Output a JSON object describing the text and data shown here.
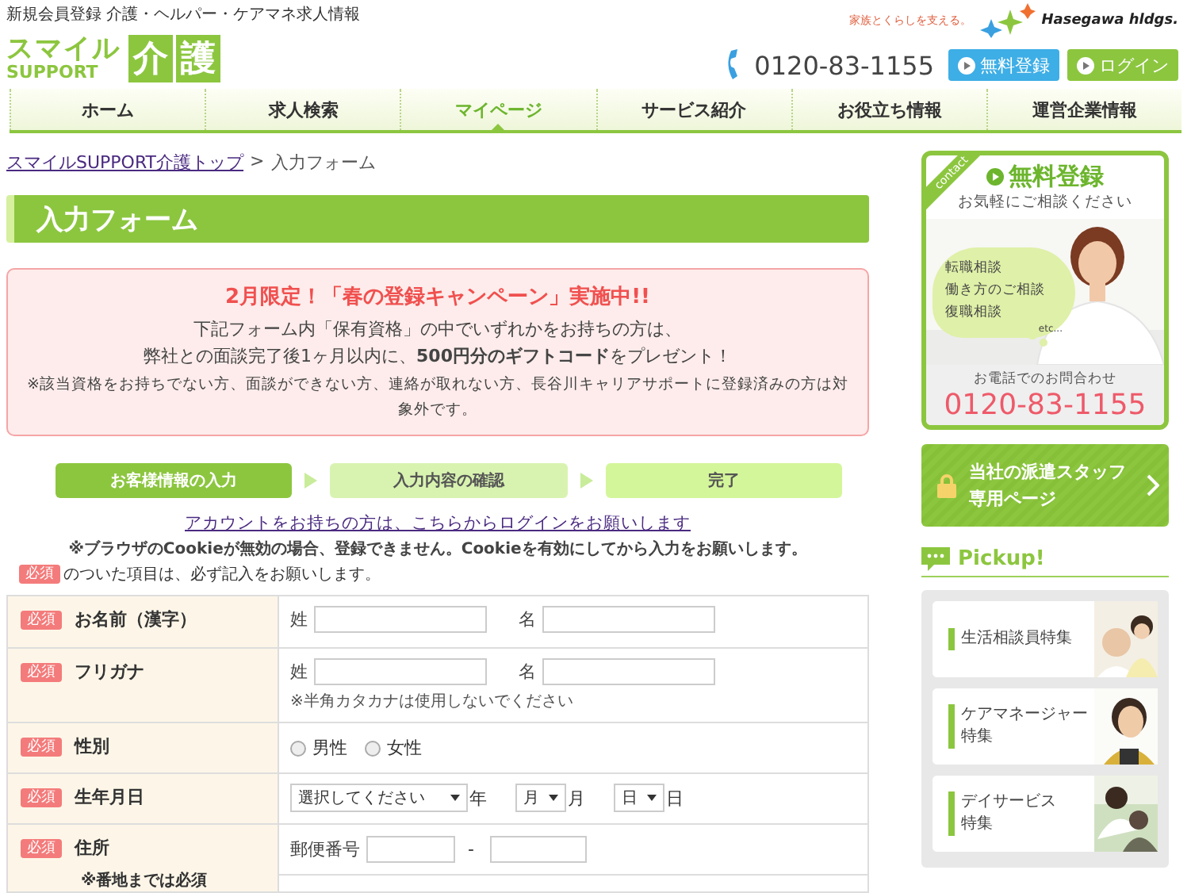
{
  "header": {
    "tagline": "新規会員登録 介護・ヘルパー・ケアマネ求人情報",
    "logo": {
      "line1": "スマイル",
      "line2": "SUPPORT",
      "kanji": [
        "介",
        "護"
      ]
    },
    "group_slogan": "家族とくらしを支える。",
    "group_name": "Hasegawa hldgs.",
    "phone": "0120-83-1155",
    "buttons": [
      {
        "label": "無料登録",
        "kind": "register"
      },
      {
        "label": "ログイン",
        "kind": "login"
      }
    ]
  },
  "nav": [
    {
      "label": "ホーム",
      "selected": false
    },
    {
      "label": "求人検索",
      "selected": false
    },
    {
      "label": "マイページ",
      "selected": true
    },
    {
      "label": "サービス紹介",
      "selected": false
    },
    {
      "label": "お役立ち情報",
      "selected": false
    },
    {
      "label": "運営企業情報",
      "selected": false
    }
  ],
  "breadcrumb": {
    "link": "スマイルSUPPORT介護トップ",
    "separator": ">",
    "current": "入力フォーム"
  },
  "page_title": "入力フォーム",
  "campaign": {
    "title": "2月限定！「春の登録キャンペーン」実施中!!",
    "lines": [
      "下記フォーム内「保有資格」の中でいずれかをお持ちの方は、",
      "弊社との面談完了後1ヶ月以内に、**500円分のギフトコード**をプレゼント！"
    ],
    "note": "※該当資格をお持ちでない方、面談ができない方、連絡が取れない方、長谷川キャリアサポートに登録済みの方は対象外です。"
  },
  "steps": [
    {
      "label": "お客様情報の入力",
      "selected": true
    },
    {
      "label": "入力内容の確認",
      "selected": false
    },
    {
      "label": "完了",
      "selected": false
    }
  ],
  "login_link": "アカウントをお持ちの方は、こちらからログインをお願いします",
  "cookie_note": "※ブラウザのCookieが無効の場合、登録できません。Cookieを有効にしてから入力をお願いします。",
  "required_note": {
    "badge": "必須",
    "text": "のついた項目は、必ず記入をお願いします。"
  },
  "form_rows": [
    {
      "label": "お名前（漢字）",
      "badge": "必須",
      "kind": "name",
      "fields": [
        {
          "label": "姓"
        },
        {
          "label": "名"
        }
      ]
    },
    {
      "label": "フリガナ",
      "badge": "必須",
      "kind": "name",
      "fields": [
        {
          "label": "姓"
        },
        {
          "label": "名"
        }
      ],
      "hint": "※半角カタカナは使用しないでください"
    },
    {
      "label": "性別",
      "badge": "必須",
      "kind": "radio",
      "options": [
        {
          "label": "男性",
          "checked": false
        },
        {
          "label": "女性",
          "checked": false
        }
      ]
    },
    {
      "label": "生年月日",
      "badge": "必須",
      "kind": "date",
      "selects": [
        {
          "value": "選択してください",
          "unit": "年"
        },
        {
          "value": "月",
          "unit": "月"
        },
        {
          "value": "日",
          "unit": "日"
        }
      ]
    },
    {
      "label": "住所",
      "badge": "必須",
      "kind": "address",
      "note": "※番地までは必須",
      "postal_label": "郵便番号",
      "postal_separator": "-"
    }
  ],
  "sidebar": {
    "contact": {
      "ribbon": "contact",
      "title": "無料登録",
      "subtitle": "お気軽にご相談ください",
      "bubble": [
        "転職相談",
        "働き方のご相談",
        "復職相談"
      ],
      "etc": "etc...",
      "phone_label": "お電話でのお問合わせ",
      "phone": "0120-83-1155"
    },
    "staff_button": [
      "当社の派遣スタッフ",
      "専用ページ"
    ],
    "pickup": {
      "title": "Pickup!",
      "items": [
        {
          "lines": [
            "生活相談員特集"
          ]
        },
        {
          "lines": [
            "ケアマネージャー",
            "特集"
          ]
        },
        {
          "lines": [
            "デイサービス",
            "特集"
          ]
        }
      ]
    }
  }
}
